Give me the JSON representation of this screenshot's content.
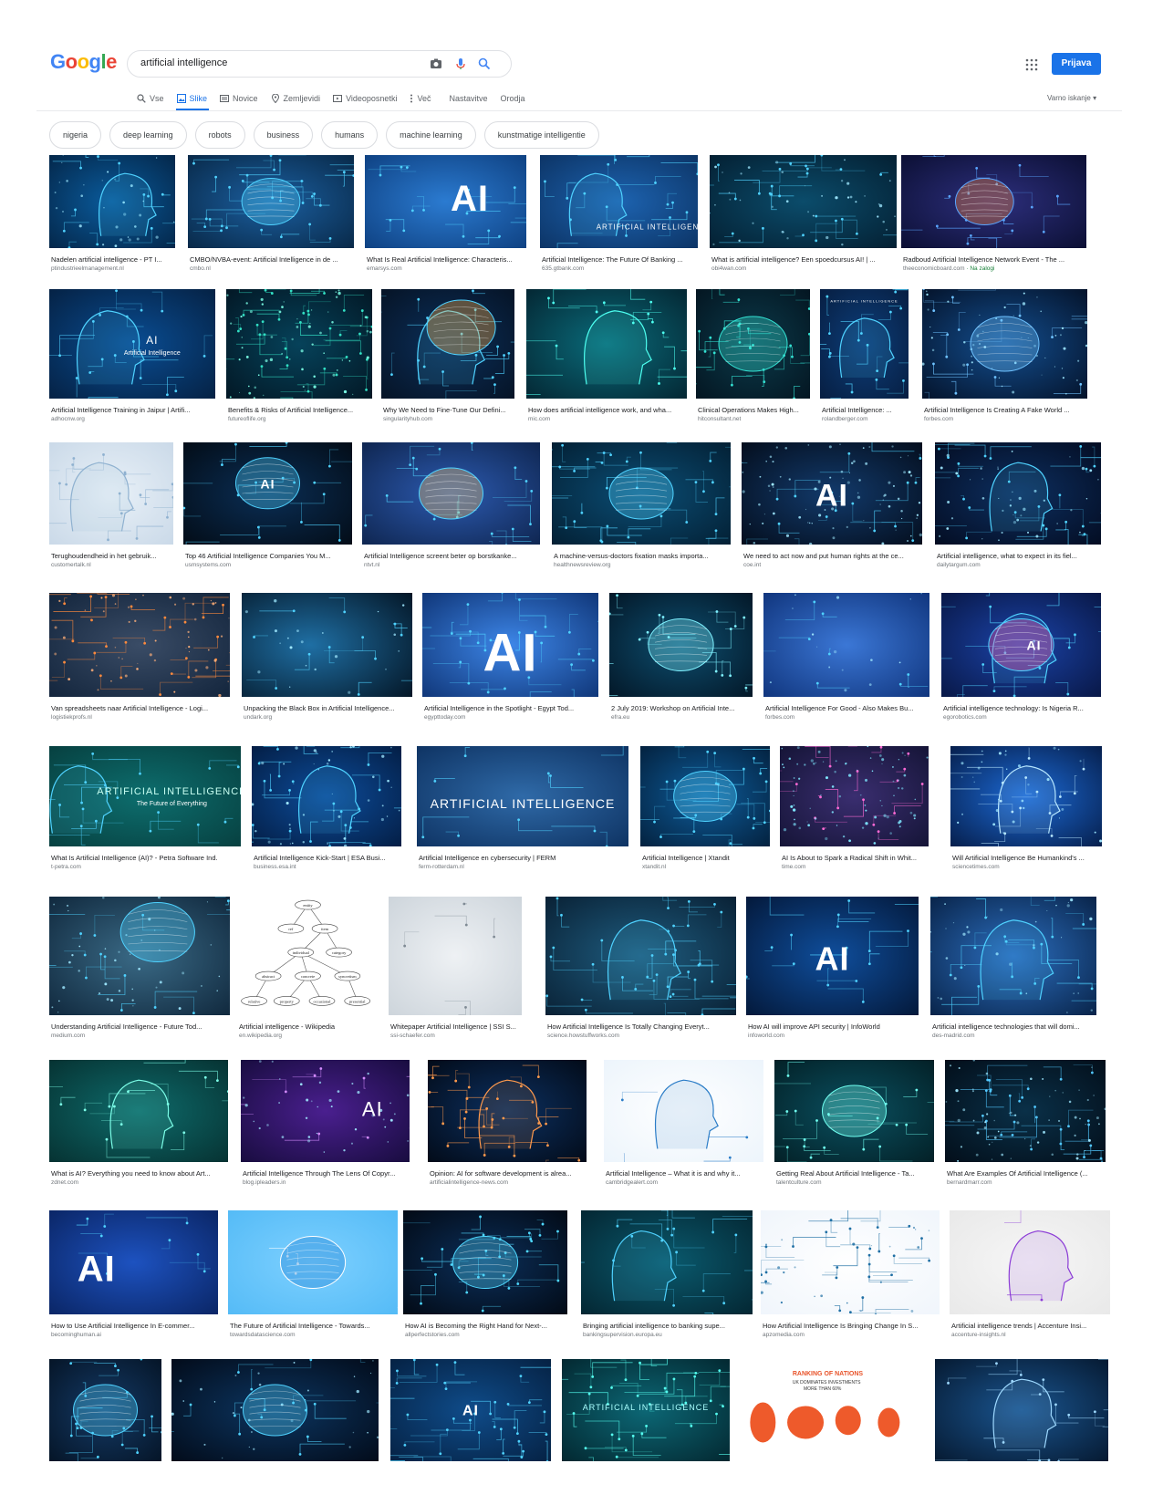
{
  "header": {
    "logo": "Google",
    "query": "artificial intelligence",
    "signin_label": "Prijava"
  },
  "tabs": [
    {
      "label": "Vse",
      "icon": "search-icon",
      "active": false
    },
    {
      "label": "Slike",
      "icon": "image-icon",
      "active": true
    },
    {
      "label": "Novice",
      "icon": "news-icon",
      "active": false
    },
    {
      "label": "Zemljevidi",
      "icon": "map-pin-icon",
      "active": false
    },
    {
      "label": "Videoposnetki",
      "icon": "video-icon",
      "active": false
    },
    {
      "label": "Več",
      "icon": "more-icon",
      "active": false
    },
    {
      "label": "Nastavitve",
      "icon": "",
      "active": false
    },
    {
      "label": "Orodja",
      "icon": "",
      "active": false
    }
  ],
  "safe_search_label": "Varno iskanje",
  "chips": [
    "nigeria",
    "deep learning",
    "robots",
    "business",
    "humans",
    "machine learning",
    "kunstmatige intelligentie"
  ],
  "results": [
    {
      "title": "Nadelen artificial intelligence - PT I...",
      "source": "ptindustrieelmanagement.nl"
    },
    {
      "title": "CMBO/NVBA-event: Artificial Intelligence in de ...",
      "source": "cmbo.nl"
    },
    {
      "title": "What Is Real Artificial Intelligence: Characteris...",
      "source": "emarsys.com"
    },
    {
      "title": "Artificial Intelligence: The Future Of Banking ...",
      "source": "635.gtbank.com"
    },
    {
      "title": "What is artificial intelligence? Een spoedcursus AI! | ...",
      "source": "obi4wan.com"
    },
    {
      "title": "Radboud Artificial Intelligence Network Event - The ...",
      "source": "theeconomicboard.com",
      "badge": "· Na zalogi"
    },
    {
      "title": "Artificial Intelligence Training in Jaipur | Artifi...",
      "source": "adhocnw.org"
    },
    {
      "title": "Benefits & Risks of Artificial Intelligence...",
      "source": "futureoflife.org"
    },
    {
      "title": "Why We Need to Fine-Tune Our Defini...",
      "source": "singularityhub.com"
    },
    {
      "title": "How does artificial intelligence work, and wha...",
      "source": "mic.com"
    },
    {
      "title": "Clinical Operations Makes High...",
      "source": "hitconsultant.net"
    },
    {
      "title": "Artificial Intelligence: ...",
      "source": "rolandberger.com"
    },
    {
      "title": "Artificial Intelligence Is Creating A Fake World ...",
      "source": "forbes.com"
    },
    {
      "title": "Terughoudendheid in het gebruik...",
      "source": "customertalk.nl"
    },
    {
      "title": "Top 46 Artificial Intelligence Companies You M...",
      "source": "usmsystems.com"
    },
    {
      "title": "Artificial Intelligence screent beter op borstkanke...",
      "source": "ntvt.nl"
    },
    {
      "title": "A machine-versus-doctors fixation masks importa...",
      "source": "healthnewsreview.org"
    },
    {
      "title": "We need to act now and put human rights at the ce...",
      "source": "coe.int"
    },
    {
      "title": "Artificial intelligence, what to expect in its fiel...",
      "source": "dailytargum.com"
    },
    {
      "title": "Van spreadsheets naar Artificial Intelligence - Logi...",
      "source": "logistiekprofs.nl"
    },
    {
      "title": "Unpacking the Black Box in Artificial Intelligence...",
      "source": "undark.org"
    },
    {
      "title": "Artificial Intelligence in the Spotlight - Egypt Tod...",
      "source": "egypttoday.com"
    },
    {
      "title": "2 July 2019: Workshop on Artificial Inte...",
      "source": "efra.eu"
    },
    {
      "title": "Artificial Intelligence For Good - Also Makes Bu...",
      "source": "forbes.com"
    },
    {
      "title": "Artificial intelligence technology: Is Nigeria R...",
      "source": "egorobotics.com"
    },
    {
      "title": "What Is Artificial Intelligence (AI)? - Petra Software Ind.",
      "source": "t-petra.com"
    },
    {
      "title": "Artificial Intelligence Kick-Start | ESA Busi...",
      "source": "business.esa.int"
    },
    {
      "title": "Artificial Intelligence en cybersecurity | FERM",
      "source": "ferm-rotterdam.nl"
    },
    {
      "title": "Artificial Intelligence | Xtandit",
      "source": "xtandit.nl"
    },
    {
      "title": "AI Is About to Spark a Radical Shift in Whit...",
      "source": "time.com"
    },
    {
      "title": "Will Artificial Intelligence Be Humankind's ...",
      "source": "sciencetimes.com"
    },
    {
      "title": "Understanding Artificial Intelligence - Future Tod...",
      "source": "medium.com"
    },
    {
      "title": "Artificial intelligence - Wikipedia",
      "source": "en.wikipedia.org"
    },
    {
      "title": "Whitepaper Artificial Intelligence | SSI S...",
      "source": "ssi-schaefer.com"
    },
    {
      "title": "How Artificial Intelligence Is Totally Changing Everyt...",
      "source": "science.howstuffworks.com"
    },
    {
      "title": "How AI will improve API security | InfoWorld",
      "source": "infoworld.com"
    },
    {
      "title": "Artificial intelligence technologies that will domi...",
      "source": "des-madrid.com"
    },
    {
      "title": "What is AI? Everything you need to know about Art...",
      "source": "zdnet.com"
    },
    {
      "title": "Artificial Intelligence Through The Lens Of Copyr...",
      "source": "blog.ipleaders.in"
    },
    {
      "title": "Opinion: AI for software development is alrea...",
      "source": "artificialintelligence-news.com"
    },
    {
      "title": "Artificial Intelligence – What it is and why it...",
      "source": "cambridgealert.com"
    },
    {
      "title": "Getting Real About Artificial Intelligence - Ta...",
      "source": "talentculture.com"
    },
    {
      "title": "What Are Examples Of Artificial Intelligence (...",
      "source": "bernardmarr.com"
    },
    {
      "title": "How to Use Artificial Intelligence In E-commer...",
      "source": "becominghuman.ai"
    },
    {
      "title": "The Future of Artificial Intelligence - Towards...",
      "source": "towardsdatascience.com"
    },
    {
      "title": "How AI is Becoming the Right Hand for Next-...",
      "source": "allperfectstories.com"
    },
    {
      "title": "Bringing artificial intelligence to banking supe...",
      "source": "bankingsupervision.europa.eu"
    },
    {
      "title": "How Artificial Intelligence Is Bringing Change In S...",
      "source": "apzomedia.com"
    },
    {
      "title": "Artificial intelligence trends | Accenture Insi...",
      "source": "accenture-insights.nl"
    },
    {
      "title": "",
      "source": ""
    },
    {
      "title": "",
      "source": ""
    },
    {
      "title": "",
      "source": ""
    },
    {
      "title": "",
      "source": ""
    },
    {
      "title": "",
      "source": ""
    },
    {
      "title": "",
      "source": ""
    }
  ],
  "thumb_texts": {
    "intelligence_text": "ARTIFICIAL INTELLIGENCE",
    "ai_text": "AI",
    "artificial_intelligence_label": "Artificial Intelligence",
    "future_text": "The Future of Everything",
    "wiki_nodes": [
      "entity",
      "ref",
      "item",
      "individual",
      "category",
      "abstract",
      "concrete",
      "syncretism",
      "relative",
      "property",
      "occasional",
      "presential"
    ],
    "nations_title": "RANKING OF NATIONS",
    "nations_sub": "UK DOMINATES INVESTMENTS",
    "nations_sub2": "MORE THAN 60%"
  },
  "colors": {
    "accent": "#1a73e8",
    "logo": [
      "#4285f4",
      "#ea4335",
      "#fbbc05",
      "#4285f4",
      "#34a853",
      "#ea4335"
    ]
  }
}
